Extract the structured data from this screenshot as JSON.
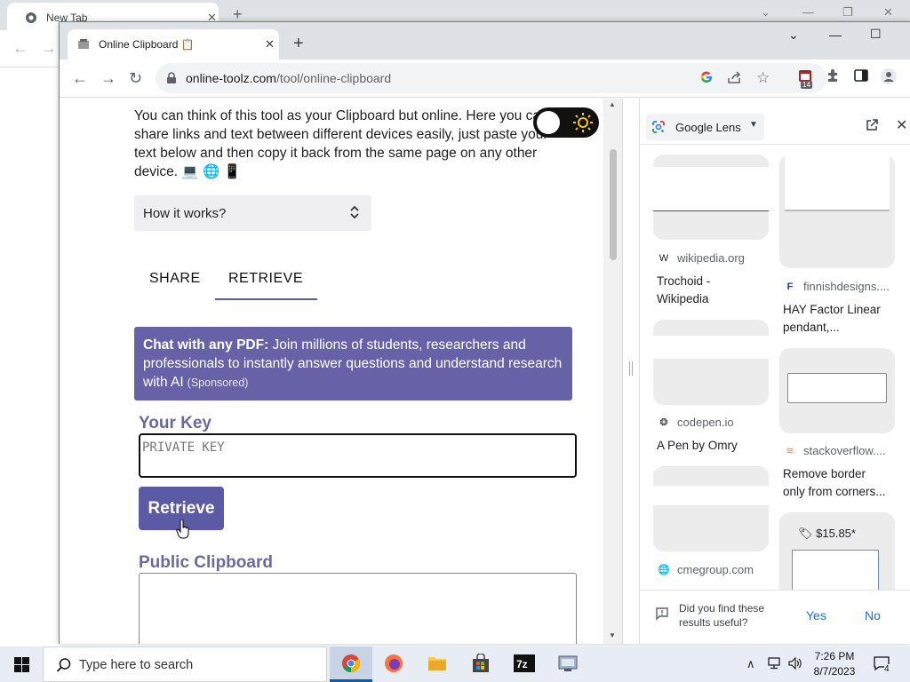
{
  "background_window": {
    "tab_title": "New Tab"
  },
  "browser": {
    "tab_title": "Online Clipboard 📋",
    "url_host": "online-toolz.com",
    "url_path": "/tool/online-clipboard",
    "extension_badge": "14"
  },
  "page": {
    "intro": "You can think of this tool as your Clipboard but online. Here you can share links and text between different devices easily, just paste your text below and then copy it back from the same page on any other device. 💻 🌐 📱",
    "how_it_works": "How it works?",
    "tabs": [
      {
        "label": "SHARE"
      },
      {
        "label": "RETRIEVE"
      }
    ],
    "ad": {
      "bold": "Chat with any PDF:",
      "text": " Join millions of students, researchers and professionals to instantly answer questions and understand research with AI",
      "sponsored": "(Sponsored)"
    },
    "your_key_label": "Your Key",
    "key_placeholder": "PRIVATE KEY",
    "retrieve_button": "Retrieve",
    "public_clipboard_label": "Public Clipboard"
  },
  "side_panel": {
    "title": "Google Lens",
    "results": [
      {
        "source": "wikipedia.org",
        "source_icon": "W",
        "title_lines": [
          "Trochoid -",
          "Wikipedia"
        ]
      },
      {
        "source": "finnishdesigns....",
        "source_icon": "F",
        "title_lines": [
          "HAY Factor Linear",
          "pendant,..."
        ]
      },
      {
        "source": "codepen.io",
        "source_icon": "❂",
        "title_lines": [
          "A Pen by Omry"
        ]
      },
      {
        "source": "stackoverflow....",
        "source_icon": "≋",
        "title_lines": [
          "Remove border",
          "only from corners..."
        ]
      },
      {
        "source": "cmegroup.com",
        "source_icon": "🌐",
        "title_lines": []
      }
    ],
    "price": "$15.85*",
    "feedback_question": "Did you find these results useful?",
    "yes": "Yes",
    "no": "No"
  },
  "taskbar": {
    "search_placeholder": "Type here to search",
    "time": "7:26 PM",
    "date": "8/7/2023",
    "notification_count": "4"
  },
  "colors": {
    "accent": "#6761a8",
    "button": "#5d5aa5",
    "label": "#6a6a9f",
    "link_blue": "#1a73e8"
  }
}
